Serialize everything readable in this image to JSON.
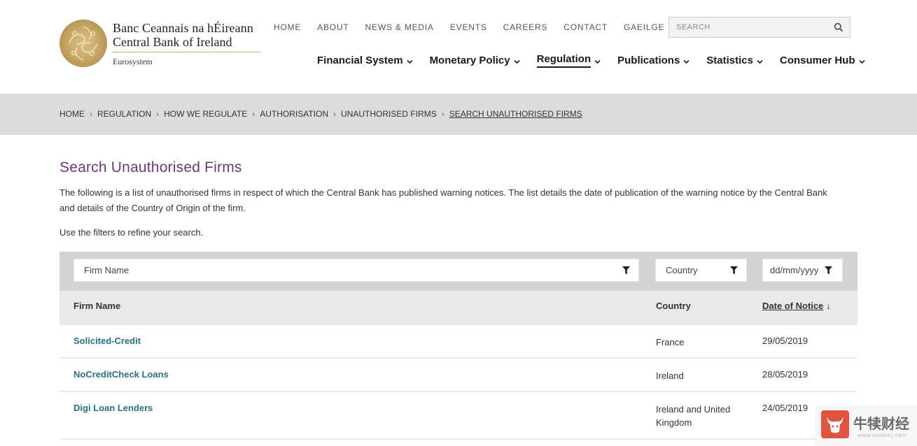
{
  "header": {
    "logo": {
      "line1": "Banc Ceannais na hÉireann",
      "line2": "Central Bank of Ireland",
      "line3": "Eurosystem"
    },
    "top_nav": [
      "HOME",
      "ABOUT",
      "NEWS & MEDIA",
      "EVENTS",
      "CAREERS",
      "CONTACT",
      "GAEILGE"
    ],
    "search": {
      "placeholder": "SEARCH",
      "icon": "search-icon"
    },
    "main_nav": [
      {
        "label": "Financial System",
        "active": false
      },
      {
        "label": "Monetary Policy",
        "active": false
      },
      {
        "label": "Regulation",
        "active": true
      },
      {
        "label": "Publications",
        "active": false
      },
      {
        "label": "Statistics",
        "active": false
      },
      {
        "label": "Consumer Hub",
        "active": false
      }
    ]
  },
  "breadcrumb": [
    "HOME",
    "REGULATION",
    "HOW WE REGULATE",
    "AUTHORISATION",
    "UNAUTHORISED FIRMS",
    "SEARCH UNAUTHORISED FIRMS"
  ],
  "page": {
    "title": "Search Unauthorised Firms",
    "intro": "The following is a list of unauthorised firms in respect of which the Central Bank has published warning notices. The list details the date of publication of the warning notice by the Central Bank and details of the Country of Origin of the firm.",
    "filter_hint": "Use the filters to refine your search."
  },
  "table": {
    "filters": {
      "firm_name_placeholder": "Firm Name",
      "country_placeholder": "Country",
      "date_placeholder": "dd/mm/yyyy"
    },
    "headers": {
      "firm": "Firm Name",
      "country": "Country",
      "date": "Date of Notice",
      "sort_indicator": "↓"
    },
    "rows": [
      {
        "firm": "Solicited-Credit",
        "country": "France",
        "date": "29/05/2019"
      },
      {
        "firm": "NoCreditCheck Loans",
        "country": "Ireland",
        "date": "28/05/2019"
      },
      {
        "firm": "Digi Loan Lenders",
        "country": "Ireland and United Kingdom",
        "date": "24/05/2019"
      }
    ]
  },
  "watermark": {
    "text": "牛犊财经",
    "sub": "www.niuducj.com"
  },
  "colors": {
    "title": "#6b3a74",
    "link": "#2a6f84",
    "band": "#dcdcdc",
    "gold": "#c9a96a"
  }
}
